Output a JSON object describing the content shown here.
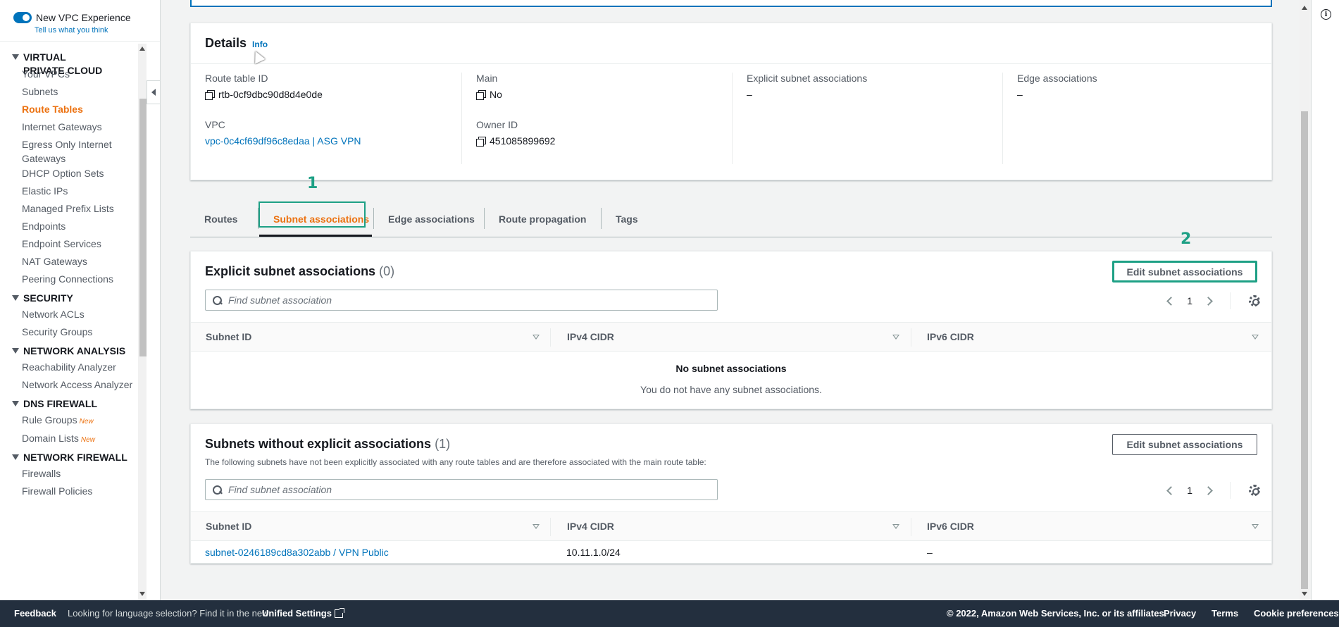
{
  "sidebar": {
    "toggle_label": "New VPC Experience",
    "tell_us": "Tell us what you think",
    "sections": [
      {
        "title": "VIRTUAL PRIVATE CLOUD",
        "items": [
          "Your VPCs",
          "Subnets",
          "Route Tables",
          "Internet Gateways",
          "Egress Only Internet Gateways",
          "DHCP Option Sets",
          "Elastic IPs",
          "Managed Prefix Lists",
          "Endpoints",
          "Endpoint Services",
          "NAT Gateways",
          "Peering Connections"
        ]
      },
      {
        "title": "SECURITY",
        "items": [
          "Network ACLs",
          "Security Groups"
        ]
      },
      {
        "title": "NETWORK ANALYSIS",
        "items": [
          "Reachability Analyzer",
          "Network Access Analyzer"
        ]
      },
      {
        "title": "DNS FIREWALL",
        "items": [
          "Rule Groups",
          "Domain Lists"
        ]
      },
      {
        "title": "NETWORK FIREWALL",
        "items": [
          "Firewalls",
          "Firewall Policies"
        ]
      }
    ],
    "active_item": "Route Tables",
    "new_badge": "New"
  },
  "details": {
    "title": "Details",
    "info": "Info",
    "route_table_id_label": "Route table ID",
    "route_table_id": "rtb-0cf9dbc90d8d4e0de",
    "vpc_label": "VPC",
    "vpc": "vpc-0c4cf69df96c8edaa | ASG VPN",
    "main_label": "Main",
    "main": "No",
    "owner_label": "Owner ID",
    "owner": "451085899692",
    "explicit_label": "Explicit subnet associations",
    "explicit": "–",
    "edge_label": "Edge associations",
    "edge": "–"
  },
  "tabs": [
    "Routes",
    "Subnet associations",
    "Edge associations",
    "Route propagation",
    "Tags"
  ],
  "annotations": {
    "one": "1",
    "two": "2"
  },
  "explicit_panel": {
    "title": "Explicit subnet associations",
    "count": "(0)",
    "edit_button": "Edit subnet associations",
    "search_placeholder": "Find subnet association",
    "page": "1",
    "columns": [
      "Subnet ID",
      "IPv4 CIDR",
      "IPv6 CIDR"
    ],
    "empty_title": "No subnet associations",
    "empty_desc": "You do not have any subnet associations."
  },
  "without_panel": {
    "title": "Subnets without explicit associations",
    "count": "(1)",
    "description": "The following subnets have not been explicitly associated with any route tables and are therefore associated with the main route table:",
    "edit_button": "Edit subnet associations",
    "search_placeholder": "Find subnet association",
    "page": "1",
    "columns": [
      "Subnet ID",
      "IPv4 CIDR",
      "IPv6 CIDR"
    ],
    "rows": [
      {
        "subnet": "subnet-0246189cd8a302abb / VPN Public",
        "ipv4": "10.11.1.0/24",
        "ipv6": "–"
      }
    ]
  },
  "footer": {
    "feedback": "Feedback",
    "lang_text": "Looking for language selection? Find it in the new",
    "unified": "Unified Settings",
    "copyright": "© 2022, Amazon Web Services, Inc. or its affiliates.",
    "privacy": "Privacy",
    "terms": "Terms",
    "cookies": "Cookie preferences"
  },
  "colors": {
    "accent": "#ec7211",
    "link": "#0073bb",
    "annotation": "#1ea085",
    "footer_bg": "#232f3e"
  }
}
